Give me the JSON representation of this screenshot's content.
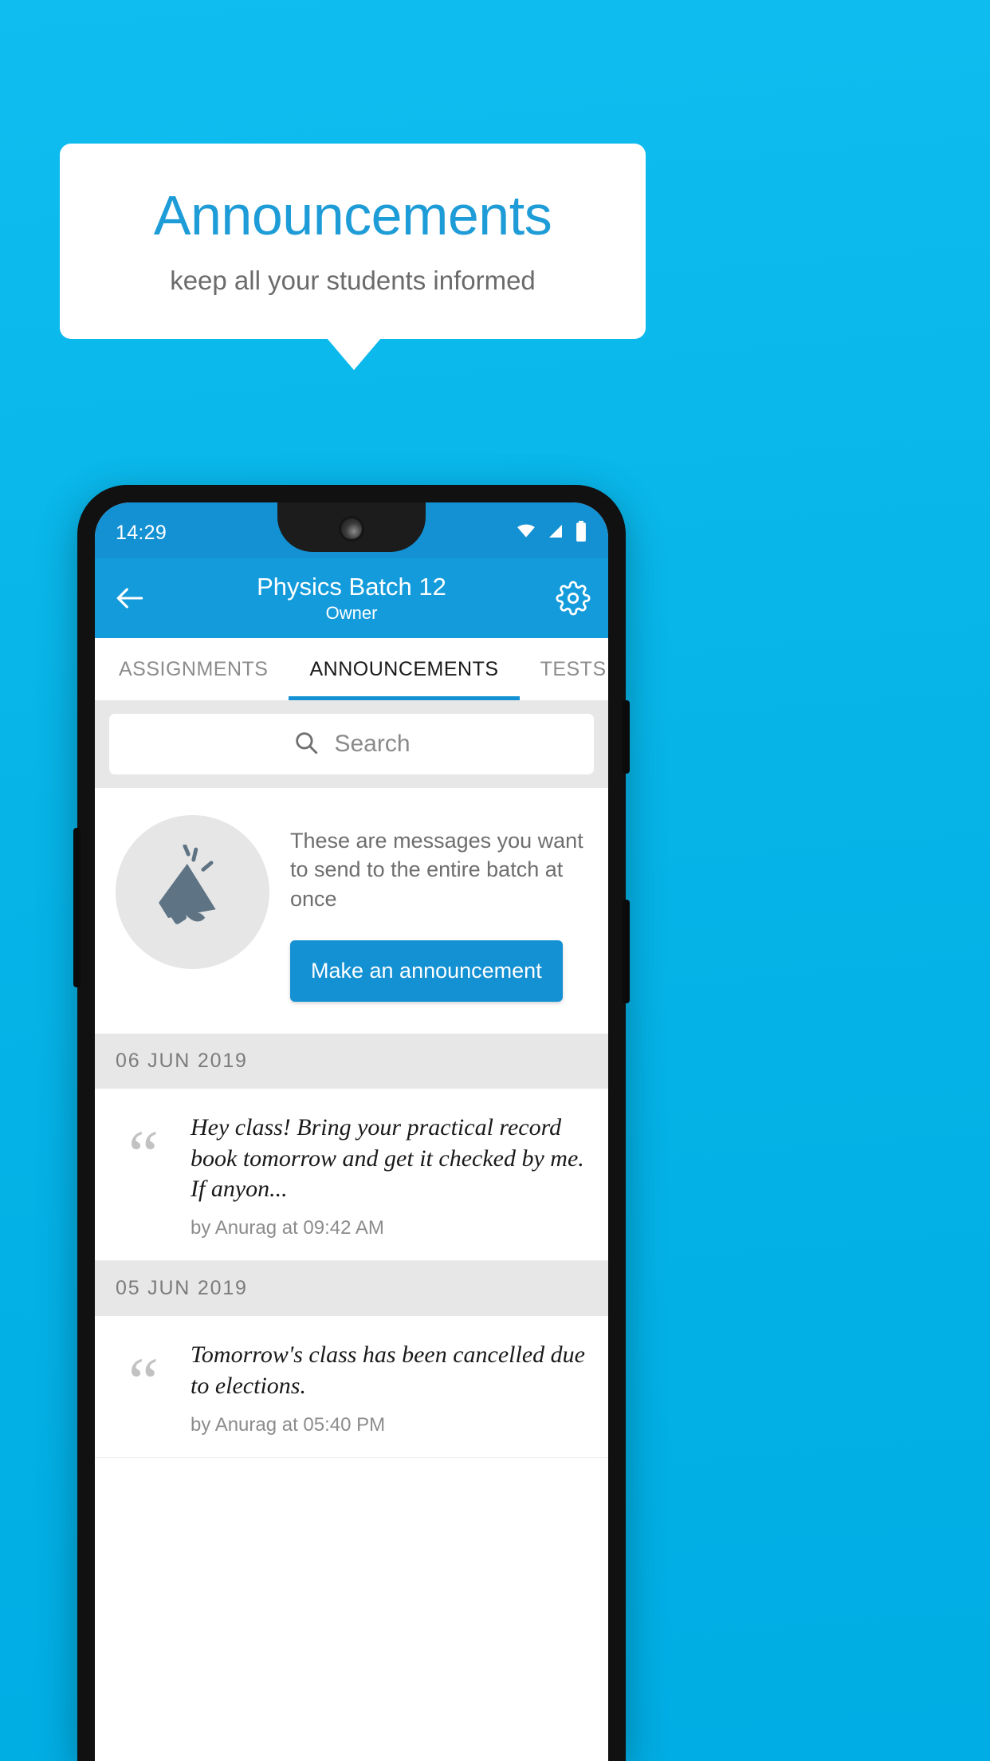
{
  "promo": {
    "title": "Announcements",
    "subtitle": "keep all your students informed",
    "bg_color": "#00B6EC",
    "title_color": "#1E9CD7",
    "card_color": "#FFFFFF"
  },
  "phone": {
    "status_bar": {
      "time": "14:29",
      "icons": [
        "wifi-icon",
        "signal-icon",
        "battery-icon"
      ],
      "background": "#1391D3"
    },
    "app_bar": {
      "back_icon": "back-arrow-icon",
      "title": "Physics Batch 12",
      "subtitle": "Owner",
      "settings_icon": "gear-icon",
      "background": "#139BDB"
    },
    "tabs": [
      {
        "label": "ASSIGNMENTS",
        "active": false
      },
      {
        "label": "ANNOUNCEMENTS",
        "active": true
      },
      {
        "label": "TESTS",
        "active": false
      }
    ],
    "tab_indicator_color": "#1391D3",
    "search": {
      "icon": "search-icon",
      "placeholder": "Search",
      "value": ""
    },
    "empty_state": {
      "icon": "megaphone-icon",
      "description": "These are messages you want to send to the entire batch at once",
      "button_label": "Make an announcement",
      "button_color": "#1391D3"
    },
    "sections": [
      {
        "date": "06  JUN  2019",
        "items": [
          {
            "quote_icon": "quote-icon",
            "text": "Hey class! Bring your practical record book tomorrow and get it checked by me. If anyon...",
            "meta": "by Anurag at 09:42 AM"
          }
        ]
      },
      {
        "date": "05  JUN  2019",
        "items": [
          {
            "quote_icon": "quote-icon",
            "text": "Tomorrow's class has been cancelled due to elections.",
            "meta": "by Anurag at 05:40 PM"
          }
        ]
      }
    ]
  }
}
